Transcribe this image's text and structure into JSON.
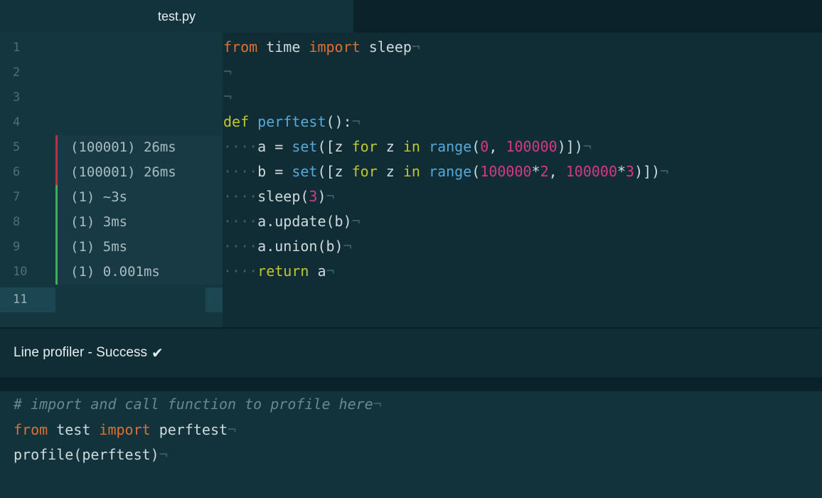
{
  "tab": {
    "title": "test.py"
  },
  "gutter": {
    "line_numbers": [
      "1",
      "2",
      "3",
      "4",
      "5",
      "6",
      "7",
      "8",
      "9",
      "10",
      "11"
    ],
    "current_line": "11",
    "profile_annotations": [
      {
        "line": "5",
        "text": "(100001) 26ms",
        "status": "slow"
      },
      {
        "line": "6",
        "text": "(100001) 26ms",
        "status": "slow"
      },
      {
        "line": "7",
        "text": "(1) ~3s",
        "status": "ok"
      },
      {
        "line": "8",
        "text": "(1) 3ms",
        "status": "ok"
      },
      {
        "line": "9",
        "text": "(1) 5ms",
        "status": "ok"
      },
      {
        "line": "10",
        "text": "(1) 0.001ms",
        "status": "ok"
      }
    ]
  },
  "code": {
    "l1": {
      "kw1": "from",
      "t1": " time ",
      "kw2": "import",
      "t2": " sleep",
      "eol": "¬"
    },
    "l2": {
      "eol": "¬"
    },
    "l3": {
      "eol": "¬"
    },
    "l4": {
      "kw": "def",
      "sp": " ",
      "fn": "perftest",
      "t": "():",
      "eol": "¬"
    },
    "l5": {
      "ws": "····",
      "t1": "a = ",
      "fn1": "set",
      "t2": "([z ",
      "kw1": "for",
      "t3": " z ",
      "kw2": "in",
      "sp": " ",
      "fn2": "range",
      "t4": "(",
      "n1": "0",
      "t5": ", ",
      "n2": "100000",
      "t6": ")])",
      "eol": "¬"
    },
    "l6": {
      "ws": "····",
      "t1": "b = ",
      "fn1": "set",
      "t2": "([z ",
      "kw1": "for",
      "t3": " z ",
      "kw2": "in",
      "sp": " ",
      "fn2": "range",
      "t4": "(",
      "n1": "100000",
      "t5": "*",
      "n2": "2",
      "t6": ", ",
      "n3": "100000",
      "t7": "*",
      "n4": "3",
      "t8": ")])",
      "eol": "¬"
    },
    "l7": {
      "ws": "····",
      "t1": "sleep(",
      "n1": "3",
      "t2": ")",
      "eol": "¬"
    },
    "l8": {
      "ws": "····",
      "t1": "a.update(b)",
      "eol": "¬"
    },
    "l9": {
      "ws": "····",
      "t1": "a.union(b)",
      "eol": "¬"
    },
    "l10": {
      "ws": "····",
      "kw": "return",
      "t1": " a",
      "eol": "¬"
    }
  },
  "panel": {
    "title": "Line profiler - Success",
    "status_icon": "check-icon",
    "status_glyph": "✔"
  },
  "console": {
    "c1": {
      "comment": "# import and call function to profile here",
      "eol": "¬"
    },
    "c2": {
      "kw1": "from",
      "t1": " test ",
      "kw2": "import",
      "t2": " perftest",
      "eol": "¬"
    },
    "c3": {
      "t1": "profile(perftest)",
      "eol": "¬"
    }
  },
  "colors": {
    "keyword": "#e0702e",
    "def_keyword": "#c4c62e",
    "function": "#57a9d8",
    "number": "#d33a83",
    "slow_marker": "#b4333e",
    "ok_marker": "#3bb05a"
  }
}
